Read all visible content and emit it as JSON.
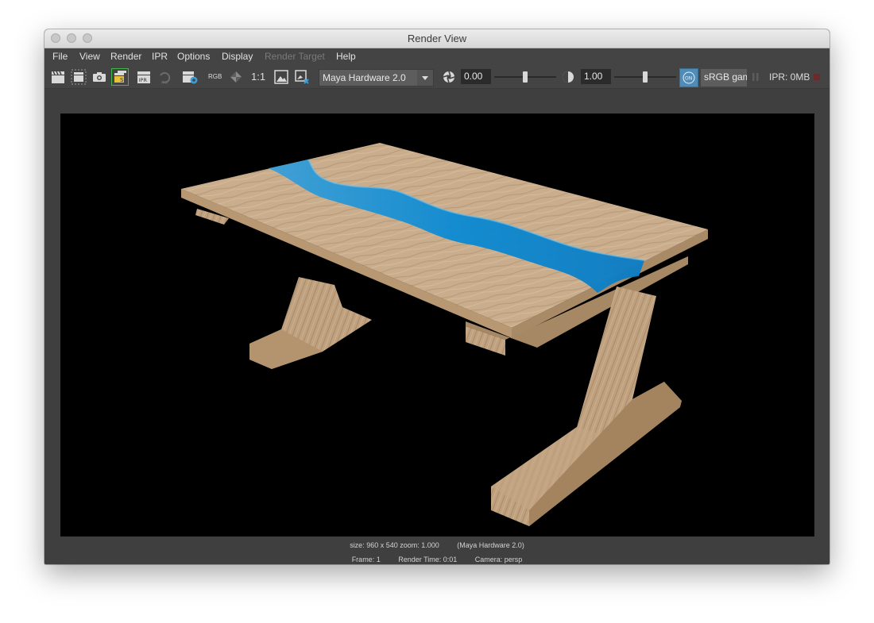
{
  "window": {
    "title": "Render View"
  },
  "menu": {
    "items": [
      {
        "label": "File",
        "enabled": true
      },
      {
        "label": "View",
        "enabled": true
      },
      {
        "label": "Render",
        "enabled": true
      },
      {
        "label": "IPR",
        "enabled": true
      },
      {
        "label": "Options",
        "enabled": true
      },
      {
        "label": "Display",
        "enabled": true
      },
      {
        "label": "Render Target",
        "enabled": false
      },
      {
        "label": "Help",
        "enabled": true
      }
    ]
  },
  "toolbar": {
    "rgb_label": "RGB",
    "ratio_label": "1:1",
    "renderer": {
      "selected": "Maya Hardware 2.0"
    },
    "exposure": {
      "value": "0.00",
      "level": 0.5
    },
    "gamma": {
      "value": "1.00",
      "level": 0.5
    },
    "color_management_on": "ON",
    "color_space": "sRGB gamma",
    "ipr_memory": "IPR: 0MB",
    "icons": {
      "redo_render": "clapper-icon",
      "render_region": "render-region-icon",
      "snapshot": "camera-snapshot-icon",
      "sequence": "render-sequence-icon",
      "ipr_render": "ipr-render-icon",
      "refresh_ipr": "ipr-refresh-icon",
      "render_settings": "render-settings-icon",
      "rgb_channel": "rgb-channel-icon",
      "alpha_channel": "alpha-channel-icon",
      "keep_image": "keep-image-icon",
      "remove_image": "remove-image-icon",
      "exposure": "aperture-icon",
      "gamma": "gamma-icon",
      "pause": "pause-icon",
      "stop": "stop-icon"
    }
  },
  "render": {
    "size_info": "size: 960 x 540  zoom: 1.000",
    "renderer_info": "(Maya Hardware 2.0)",
    "frame": "Frame: 1",
    "render_time": "Render Time: 0:01",
    "camera": "Camera: persp"
  },
  "colors": {
    "window_bg": "#444444",
    "render_bg": "#000000",
    "wood": "#c9ad8c",
    "river": "#0a8fd6",
    "accent_on": "#4f8cb8"
  }
}
